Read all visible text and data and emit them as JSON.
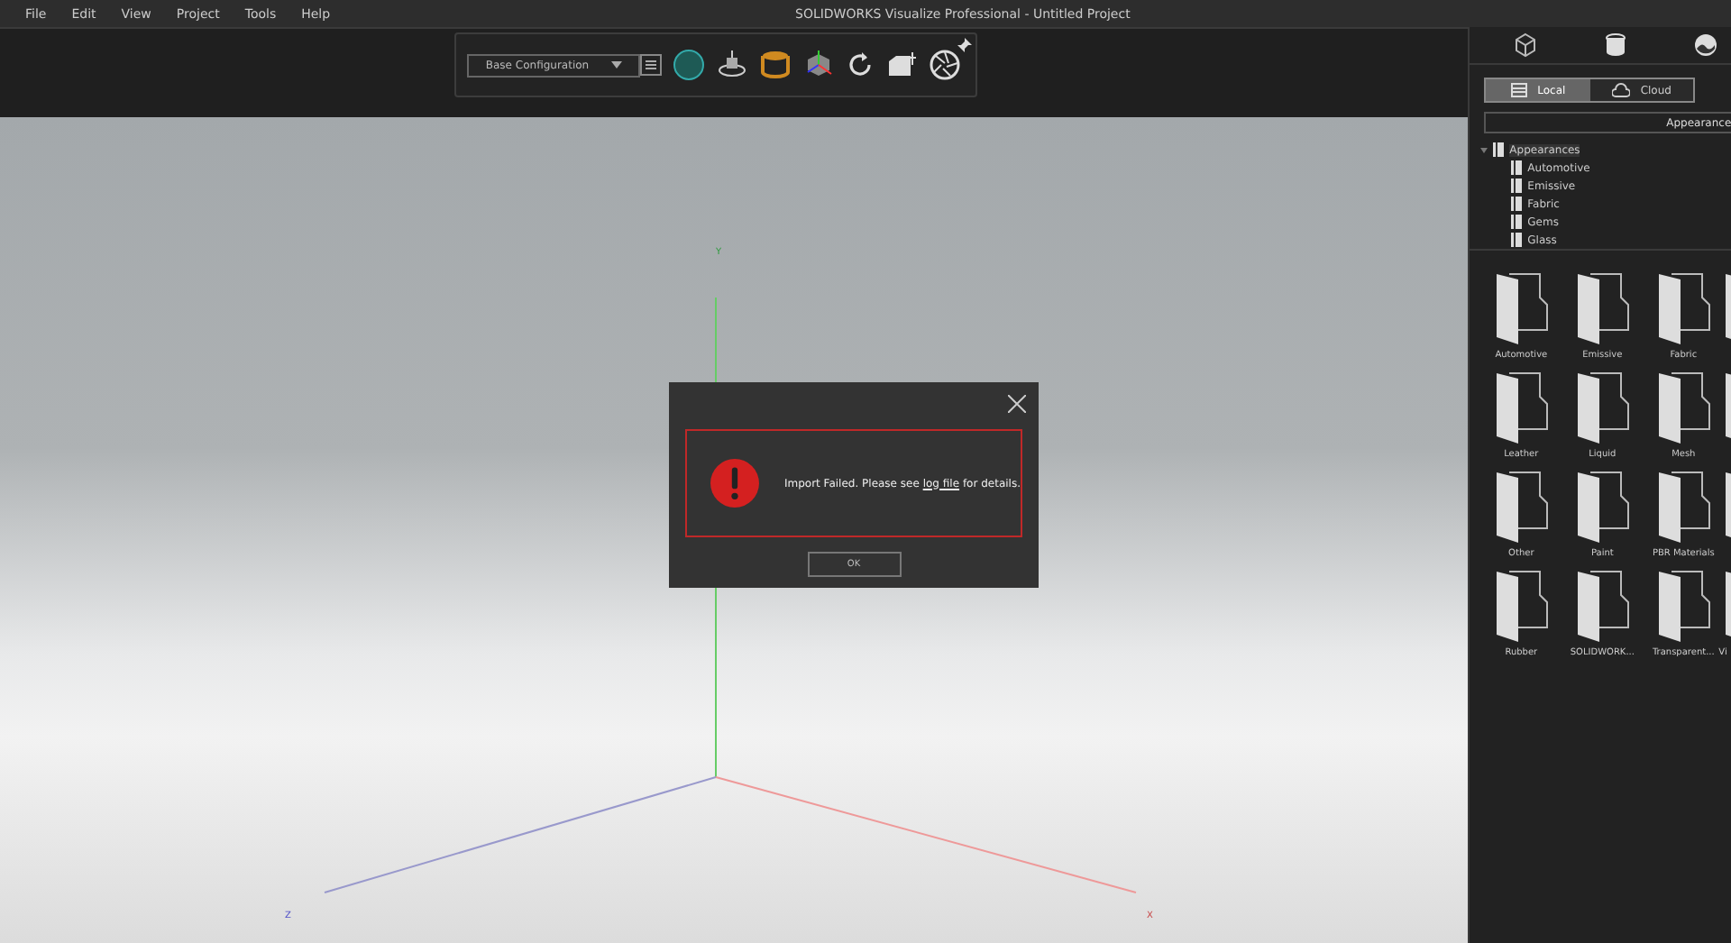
{
  "menu": [
    "File",
    "Edit",
    "View",
    "Project",
    "Tools",
    "Help"
  ],
  "window": {
    "title": "SOLIDWORKS Visualize Professional - Untitled Project"
  },
  "toolbar": {
    "configuration": "Base Configuration"
  },
  "viewport": {
    "axes": [
      "Y",
      "Z",
      "X"
    ]
  },
  "dialog": {
    "message_before": "Import Failed. Please see ",
    "link": "log file",
    "message_after": " for details.",
    "button": "OK"
  },
  "panel": {
    "source_tabs": [
      {
        "label": "Local",
        "selected": true
      },
      {
        "label": "Cloud",
        "selected": false
      }
    ],
    "path": "Appearance",
    "tree": [
      {
        "label": "Appearances",
        "selected": true,
        "expanded": true,
        "children": [
          {
            "label": "Automotive",
            "selected": false
          },
          {
            "label": "Emissive",
            "selected": false
          },
          {
            "label": "Fabric",
            "selected": false
          },
          {
            "label": "Gems",
            "selected": false
          },
          {
            "label": "Glass",
            "selected": false
          }
        ]
      }
    ],
    "folders": [
      {
        "label": "Automotive"
      },
      {
        "label": "Emissive"
      },
      {
        "label": "Fabric"
      },
      {
        "kind": "partial"
      },
      {
        "label": "Leather"
      },
      {
        "label": "Liquid"
      },
      {
        "label": "Mesh"
      },
      {
        "kind": "partial"
      },
      {
        "label": "Other"
      },
      {
        "label": "Paint"
      },
      {
        "label": "PBR Materials"
      },
      {
        "kind": "partial"
      },
      {
        "label": "Rubber"
      },
      {
        "label": "SOLIDWORK..."
      },
      {
        "label": "Transparent..."
      },
      {
        "label": "Vi",
        "kind": "partial"
      }
    ]
  }
}
